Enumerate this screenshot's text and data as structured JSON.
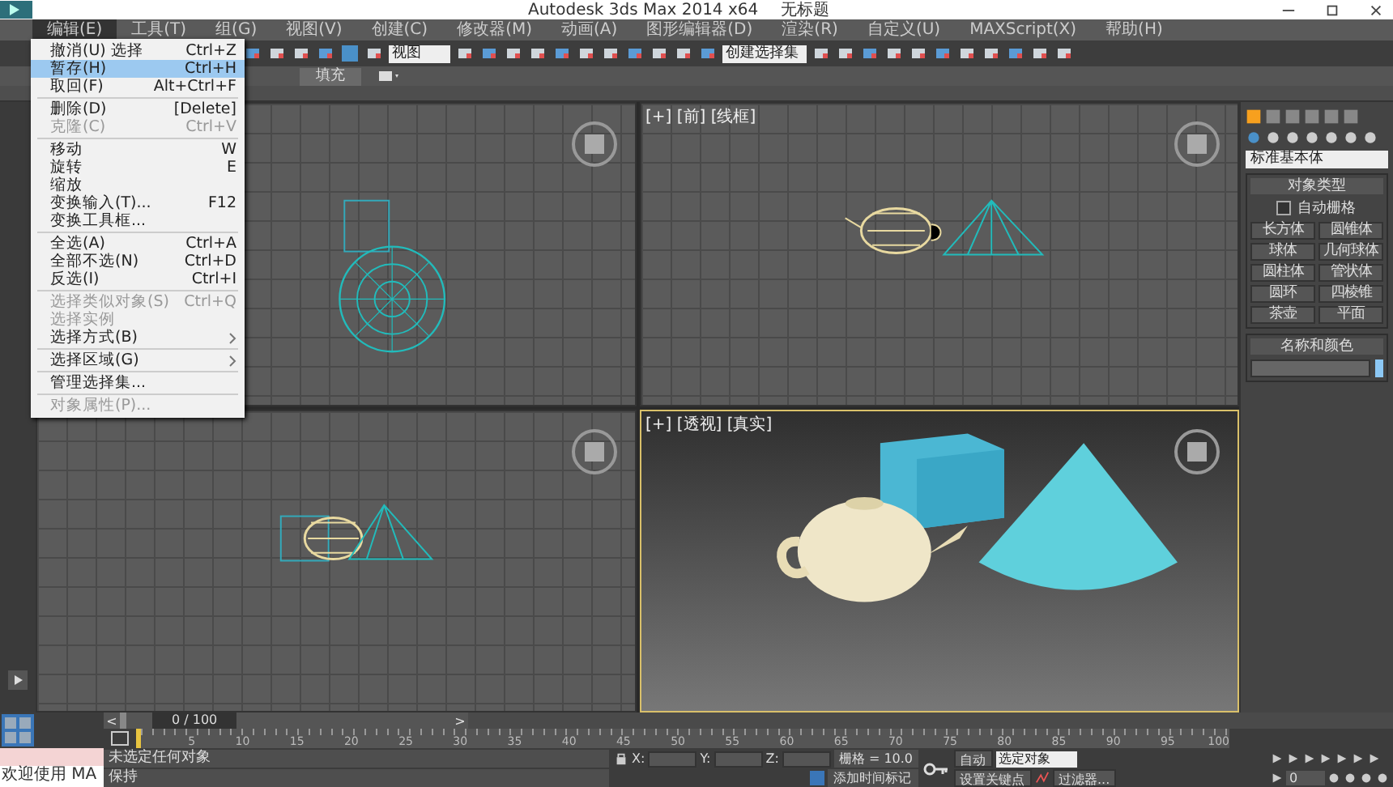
{
  "window": {
    "title": "Autodesk 3ds Max  2014 x64",
    "document": "无标题"
  },
  "menu_bar": [
    {
      "label": "编辑(E)",
      "selected": true
    },
    {
      "label": "工具(T)",
      "selected": false
    },
    {
      "label": "组(G)",
      "selected": false
    },
    {
      "label": "视图(V)",
      "selected": false
    },
    {
      "label": "创建(C)",
      "selected": false
    },
    {
      "label": "修改器(M)",
      "selected": false
    },
    {
      "label": "动画(A)",
      "selected": false
    },
    {
      "label": "图形编辑器(D)",
      "selected": false
    },
    {
      "label": "渲染(R)",
      "selected": false
    },
    {
      "label": "自定义(U)",
      "selected": false
    },
    {
      "label": "MAXScript(X)",
      "selected": false
    },
    {
      "label": "帮助(H)",
      "selected": false
    }
  ],
  "toolbar": {
    "view_dropdown": "视图",
    "selection_set_dropdown": "创建选择集"
  },
  "ribbon": {
    "tab": "填充"
  },
  "edit_menu": [
    {
      "kind": "item",
      "label": "撤消(U) 选择",
      "shortcut": "Ctrl+Z",
      "disabled": false,
      "selected": false
    },
    {
      "kind": "item",
      "label": "暂存(H)",
      "shortcut": "Ctrl+H",
      "disabled": false,
      "selected": true
    },
    {
      "kind": "item",
      "label": "取回(F)",
      "shortcut": "Alt+Ctrl+F",
      "disabled": false,
      "selected": false
    },
    {
      "kind": "separator"
    },
    {
      "kind": "item",
      "label": "删除(D)",
      "shortcut": "[Delete]",
      "disabled": false,
      "selected": false
    },
    {
      "kind": "item",
      "label": "克隆(C)",
      "shortcut": "Ctrl+V",
      "disabled": true,
      "selected": false
    },
    {
      "kind": "separator"
    },
    {
      "kind": "item",
      "label": "移动",
      "shortcut": "W",
      "disabled": false,
      "selected": false
    },
    {
      "kind": "item",
      "label": "旋转",
      "shortcut": "E",
      "disabled": false,
      "selected": false
    },
    {
      "kind": "item",
      "label": "缩放",
      "disabled": false,
      "selected": false
    },
    {
      "kind": "item",
      "label": "变换输入(T)...",
      "shortcut": "F12",
      "disabled": false,
      "selected": false
    },
    {
      "kind": "item",
      "label": "变换工具框...",
      "disabled": false,
      "selected": false
    },
    {
      "kind": "separator"
    },
    {
      "kind": "item",
      "label": "全选(A)",
      "shortcut": "Ctrl+A",
      "disabled": false,
      "selected": false
    },
    {
      "kind": "item",
      "label": "全部不选(N)",
      "shortcut": "Ctrl+D",
      "disabled": false,
      "selected": false
    },
    {
      "kind": "item",
      "label": "反选(I)",
      "shortcut": "Ctrl+I",
      "disabled": false,
      "selected": false
    },
    {
      "kind": "separator"
    },
    {
      "kind": "item",
      "label": "选择类似对象(S)",
      "shortcut": "Ctrl+Q",
      "disabled": true,
      "selected": false
    },
    {
      "kind": "item",
      "label": "选择实例",
      "disabled": true,
      "selected": false
    },
    {
      "kind": "submenu",
      "label": "选择方式(B)",
      "disabled": false,
      "selected": false
    },
    {
      "kind": "separator"
    },
    {
      "kind": "submenu",
      "label": "选择区域(G)",
      "disabled": false,
      "selected": false
    },
    {
      "kind": "separator"
    },
    {
      "kind": "item",
      "label": "管理选择集...",
      "disabled": false,
      "selected": false
    },
    {
      "kind": "separator"
    },
    {
      "kind": "item",
      "label": "对象属性(P)...",
      "disabled": true,
      "selected": false
    }
  ],
  "viewports": [
    {
      "kind": "top",
      "active": false
    },
    {
      "kind": "front",
      "label": "[+] [前] [线框]",
      "active": false
    },
    {
      "kind": "left",
      "active": false
    },
    {
      "kind": "perspective",
      "label": "[+] [透视] [真实]",
      "active": true
    }
  ],
  "command_panel": {
    "category": "标准基本体",
    "object_type_title": "对象类型",
    "autogrid": {
      "label": "自动栅格",
      "checked": false
    },
    "buttons": [
      "长方体",
      "圆锥体",
      "球体",
      "几何球体",
      "圆柱体",
      "管状体",
      "圆环",
      "四棱锥",
      "茶壶",
      "平面"
    ],
    "name_color_title": "名称和颜色",
    "color": "#8cc8f5"
  },
  "time_slider": {
    "previous": "<",
    "reading": "0 / 100",
    "next": ">",
    "level": 0
  },
  "timeline": {
    "ticks": [
      "5",
      "10",
      "15",
      "20",
      "25",
      "30",
      "35",
      "40",
      "45",
      "50",
      "55",
      "60",
      "65",
      "70",
      "75",
      "80",
      "85",
      "90",
      "95",
      "100"
    ]
  },
  "status": {
    "listener": "欢迎使用 MA",
    "selection": "未选定任何对象",
    "prompt": "保持",
    "x_label": "X:",
    "y_label": "Y:",
    "z_label": "Z:",
    "grid": "栅格 = 10.0",
    "add_time_tag": "添加时间标记",
    "auto_key": "自动",
    "key_mode": "选定对象",
    "set_key": "设置关键点",
    "filters": "过滤器...",
    "frame": "0"
  }
}
